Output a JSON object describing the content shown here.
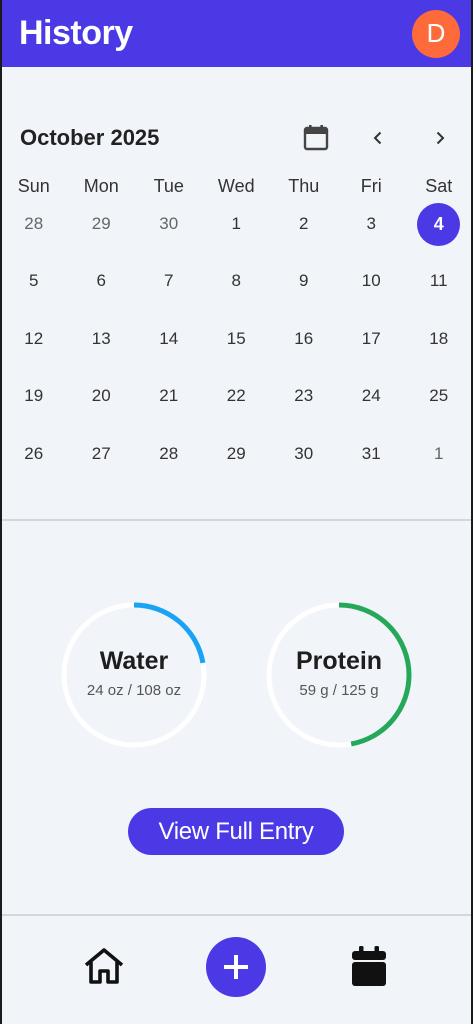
{
  "header": {
    "title": "History",
    "avatar_initial": "D"
  },
  "calendar": {
    "month_label": "October 2025",
    "weekdays": [
      "Sun",
      "Mon",
      "Tue",
      "Wed",
      "Thu",
      "Fri",
      "Sat"
    ],
    "weeks": [
      [
        "28",
        "29",
        "30",
        "1",
        "2",
        "3",
        "4"
      ],
      [
        "5",
        "6",
        "7",
        "8",
        "9",
        "10",
        "11"
      ],
      [
        "12",
        "13",
        "14",
        "15",
        "16",
        "17",
        "18"
      ],
      [
        "19",
        "20",
        "21",
        "22",
        "23",
        "24",
        "25"
      ],
      [
        "26",
        "27",
        "28",
        "29",
        "30",
        "31",
        "1"
      ]
    ],
    "selected_day": "4"
  },
  "summary": {
    "water": {
      "name": "Water",
      "value_text": "24 oz / 108 oz",
      "current": 24,
      "goal": 108,
      "color": "#1aa3f5"
    },
    "protein": {
      "name": "Protein",
      "value_text": "59 g / 125 g",
      "current": 59,
      "goal": 125,
      "color": "#25a85a"
    }
  },
  "view_full_entry_label": "View Full Entry",
  "colors": {
    "primary": "#4b39e6",
    "avatar": "#ff6a3a",
    "background": "#f1f4f9"
  }
}
